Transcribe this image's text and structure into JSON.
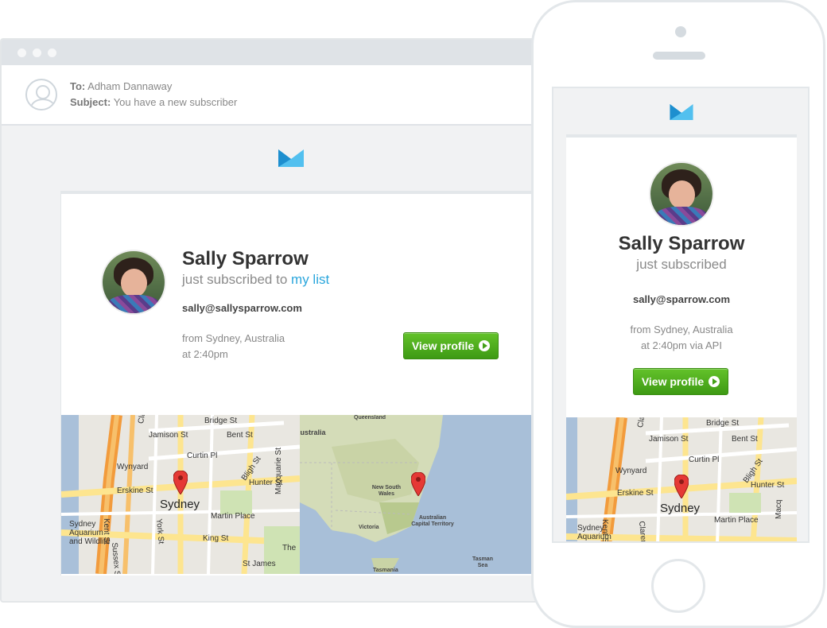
{
  "email": {
    "to_label": "To:",
    "to_value": "Adham Dannaway",
    "subject_label": "Subject:",
    "subject_value": "You have a new subscriber"
  },
  "subscriber": {
    "name": "Sally Sparrow",
    "subscribed_text": "just subscribed to",
    "list_link": "my list",
    "email": "sally@sallysparrow.com",
    "location": "from Sydney, Australia",
    "time": "at 2:40pm"
  },
  "mobile": {
    "name": "Sally Sparrow",
    "subscribed_text": "just subscribed",
    "email": "sally@sparrow.com",
    "location": "from Sydney, Australia",
    "time": "at 2:40pm via API"
  },
  "button": {
    "label": "View profile"
  },
  "map_street": {
    "city": "Sydney",
    "streets": [
      "Bridge St",
      "Jamison St",
      "Bent St",
      "Clarence St",
      "Curtin Pl",
      "Bligh St",
      "Wynyard",
      "Erskine St",
      "Hunter St",
      "Kent St",
      "Martin Place",
      "Macquarie St",
      "Sydney Aquarium and Wildlife",
      "York St",
      "King St",
      "Sussex St",
      "St James",
      "The"
    ]
  },
  "map_region": {
    "labels": [
      "Queensland",
      "Australia",
      "New South Wales",
      "Victoria",
      "Australian Capital Territory",
      "Tasman Sea",
      "Tasmania"
    ]
  },
  "phone_map": {
    "city": "Sydney",
    "streets": [
      "Bridge St",
      "Jamison St",
      "Bent St",
      "Clarence St",
      "Curtin Pl",
      "Bligh St",
      "Wynyard",
      "Erskine St",
      "Hunter St",
      "Kent St",
      "Martin Place",
      "Sydney Aquarium",
      "Claren",
      "Macq"
    ]
  },
  "colors": {
    "link": "#2aa6dc",
    "button": "#4aa91a",
    "logo": "#2aa6dc"
  }
}
